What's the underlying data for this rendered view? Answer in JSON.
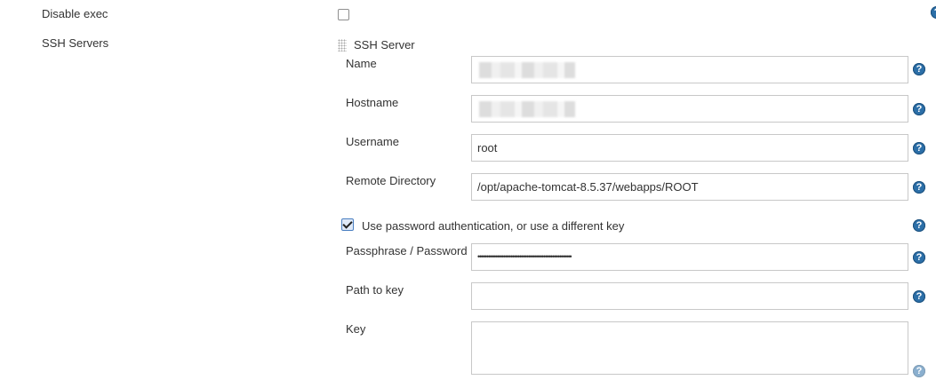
{
  "top": {
    "disable_exec_label": "Disable exec",
    "disable_exec_checked": false,
    "ssh_servers_label": "SSH Servers"
  },
  "server": {
    "header": "SSH Server",
    "name_label": "Name",
    "name_value": "",
    "hostname_label": "Hostname",
    "hostname_value": "",
    "username_label": "Username",
    "username_value": "root",
    "remote_dir_label": "Remote Directory",
    "remote_dir_value": "/opt/apache-tomcat-8.5.37/webapps/ROOT",
    "use_password_label": "Use password authentication, or use a different key",
    "use_password_checked": true,
    "passphrase_label": "Passphrase / Password",
    "passphrase_value": "••••••••••••••••••••••••••••••••••••••••••••••••••••••",
    "path_to_key_label": "Path to key",
    "path_to_key_value": "",
    "key_label": "Key",
    "key_value": ""
  },
  "icons": {
    "help": "help-icon",
    "grip": "drag-handle-icon",
    "checkbox": "checkbox"
  },
  "colors": {
    "help_icon": "#2c6fa8",
    "checkbox_checked": "#4a7fc1",
    "input_border": "#c8c8c8"
  }
}
